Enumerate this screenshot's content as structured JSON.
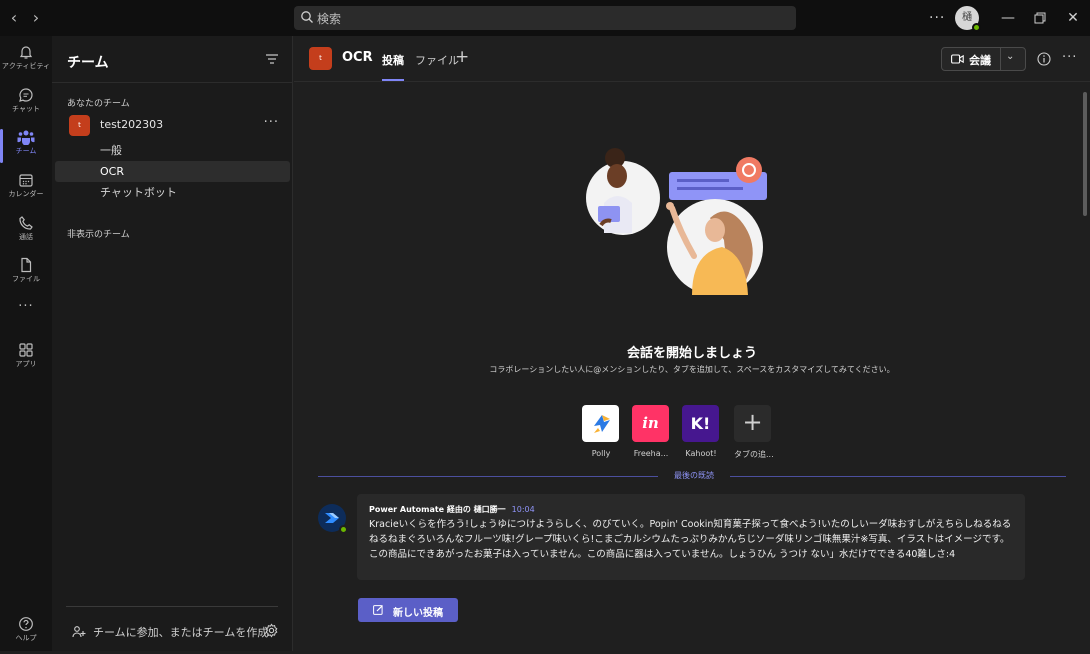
{
  "titlebar": {
    "search_placeholder": "検索",
    "avatar_initial": "樋",
    "more": "···"
  },
  "rail": {
    "items": [
      {
        "label": "アクティビティ",
        "icon": "bell-icon"
      },
      {
        "label": "チャット",
        "icon": "chat-icon"
      },
      {
        "label": "チーム",
        "icon": "teams-icon"
      },
      {
        "label": "カレンダー",
        "icon": "calendar-icon"
      },
      {
        "label": "通話",
        "icon": "phone-icon"
      },
      {
        "label": "ファイル",
        "icon": "file-icon"
      },
      {
        "label": "···",
        "icon": "more-icon"
      },
      {
        "label": "アプリ",
        "icon": "apps-icon"
      },
      {
        "label": "ヘルプ",
        "icon": "help-icon"
      }
    ],
    "accent_color": "#7f85f5"
  },
  "teams_panel": {
    "title": "チーム",
    "your_teams_label": "あなたのチーム",
    "team": {
      "initial": "t",
      "name": "test202303",
      "more": "···",
      "color": "#c43e1c"
    },
    "channels": [
      "一般",
      "OCR",
      "チャットボット"
    ],
    "hidden_teams_label": "非表示のチーム",
    "join_label": "チームに参加、またはチームを作成"
  },
  "header": {
    "channel_initial": "t",
    "channel_name": "OCR",
    "tabs": [
      "投稿",
      "ファイル"
    ],
    "meet_label": "会議",
    "more": "···"
  },
  "welcome": {
    "title": "会話を開始しましょう",
    "subtitle": "コラボレーションしたい人に@メンションしたり、タブを追加して、スペースをカスタマイズしてみてください。"
  },
  "apps": [
    {
      "name": "Polly",
      "glyph": "",
      "color": "#ffffff"
    },
    {
      "name": "Freeha...",
      "glyph": "in",
      "color": "#ff3366"
    },
    {
      "name": "Kahoot!",
      "glyph": "K!",
      "color": "#46178f"
    },
    {
      "name": "タブの追...",
      "glyph": "+",
      "color": "#2b2b2b"
    }
  ],
  "divider": {
    "label": "最後の既読"
  },
  "message": {
    "author": "Power Automate 経由の 樋口勝一",
    "time": "10:04",
    "body": "Kracieいくらを作ろう!しょうゆにつけようらしく、のびていく。Popin' Cookin知育菓子探って食べよう!いたのしいーダ味おすしがえちらしねるねるねるねまぐろいろんなフルーツ味!グレープ味いくら!こまごカルシウムたっぷりみかんちじソーダ味リンゴ味無果汁※写真、イラストはイメージです。この商品にできあがったお菓子は入っていません。この商品に器は入っていません。しょうひん うつけ ない」水だけでできる40難しさ:4"
  },
  "compose": {
    "new_post_label": "新しい投稿",
    "brand_color": "#5b5fc7"
  }
}
